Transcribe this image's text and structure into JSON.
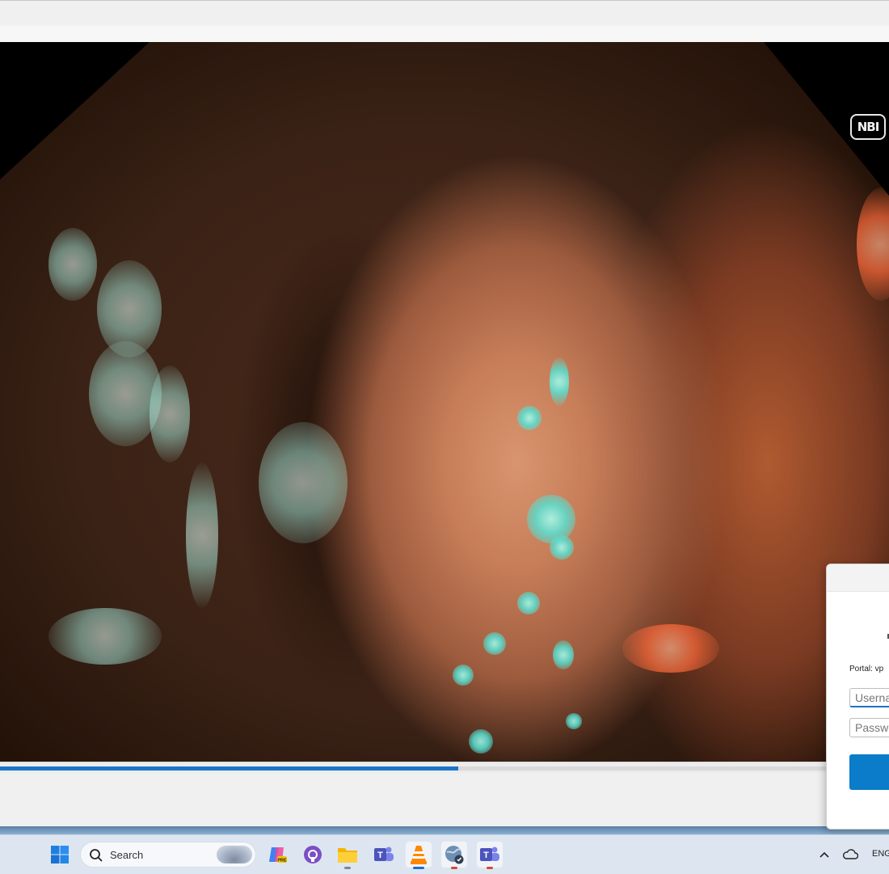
{
  "overlay": {
    "nbi_badge": "NBI"
  },
  "player": {
    "progress_fraction": 0.515
  },
  "dialog": {
    "portal_label": "Portal: vp",
    "username_placeholder": "Userna",
    "password_placeholder": "Passwo"
  },
  "taskbar": {
    "search_label": "Search",
    "language": "ENG",
    "apps": [
      "start-icon",
      "copilot-icon",
      "github-desktop-icon",
      "file-explorer-icon",
      "teams-icon",
      "vlc-icon",
      "vpn-globe-icon",
      "teams-icon-2"
    ]
  },
  "colors": {
    "accent": "#1b76c8",
    "dialog_button": "#0a7cc9",
    "taskbar": "#dde6f0"
  }
}
